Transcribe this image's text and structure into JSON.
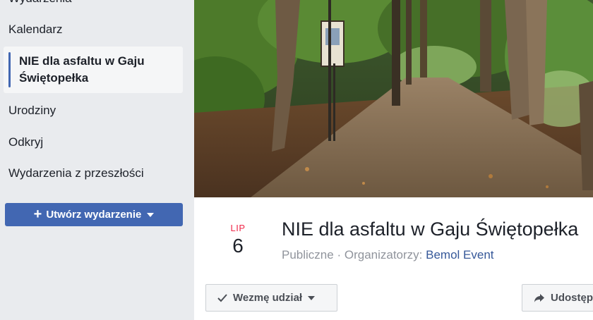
{
  "sidebar": {
    "items": [
      {
        "label": "Wydarzenia"
      },
      {
        "label": "Kalendarz"
      },
      {
        "label": "NIE dla asfaltu w Gaju Świętopełka"
      },
      {
        "label": "Urodziny"
      },
      {
        "label": "Odkryj"
      },
      {
        "label": "Wydarzenia z przeszłości"
      }
    ],
    "create_button": {
      "label": "Utwórz wydarzenie"
    }
  },
  "event": {
    "month": "LIP",
    "day": "6",
    "title": "NIE dla asfaltu w Gaju Świętopełka",
    "privacy": "Publiczne",
    "separator": "·",
    "organizers_label": "Organizatorzy:",
    "organizer": "Bemol Event",
    "going_button": "Wezmę udział",
    "share_button": "Udostępnij"
  },
  "colors": {
    "accent": "#4267b2",
    "date_month": "#f02849",
    "link": "#365899"
  },
  "icons": [
    "plus-icon",
    "caret-down-icon",
    "checkmark-icon",
    "share-arrow-icon"
  ]
}
